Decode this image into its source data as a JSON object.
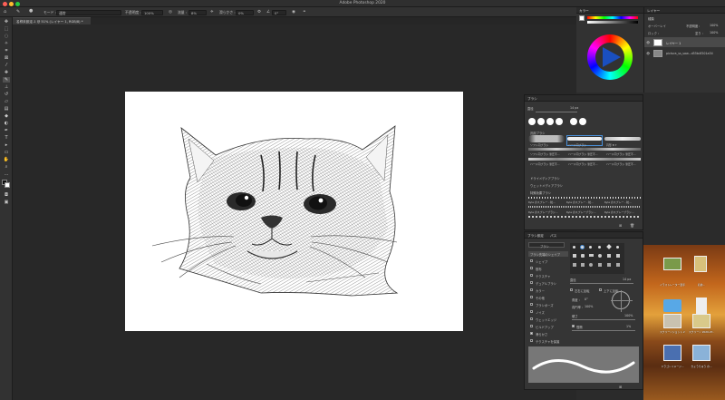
{
  "window": {
    "title": "Adobe Photoshop 2020"
  },
  "options_bar": {
    "mode_label": "モード :",
    "mode_value": "通常",
    "opacity_label": "不透明度 :",
    "opacity_value": "100%",
    "flow_label": "流量 :",
    "flow_value": "8%",
    "smoothing_label": "滑らかさ :",
    "smoothing_value": "0%",
    "angle_value": "0°"
  },
  "document_tab": {
    "label": "名称未設定-1 @ 51% (レイヤー 1, RGB/8) *"
  },
  "color_panel": {
    "title": "カラー"
  },
  "layers_panel": {
    "title": "レイヤー",
    "kind_label": "種類",
    "blend_value": "オーバーレイ",
    "opacity_label": "不透明度 :",
    "opacity_value": "100%",
    "lock_label": "ロック :",
    "fill_label": "塗り :",
    "fill_value": "100%",
    "layers": [
      {
        "name": "レイヤー 1"
      },
      {
        "name": "pictura_ss_saw...d55b4f201a34"
      }
    ]
  },
  "brush_panel": {
    "title": "ブラシ",
    "size_label": "直径",
    "size_value": "14 px",
    "groups": [
      {
        "name": "汎用ブラシ",
        "brushes": [
          "ソフト円ブラシ",
          "ハード円ブラシ",
          "円形 B 7",
          "ソフト円ブラシ 筆圧不...",
          "ハード円ブラシ 筆圧不...",
          "ハード円ブラシ 筆圧不...",
          "ハード円ブラシ 筆圧不...",
          "ハード円ブラシ 筆圧不...",
          "ハード円ブラシ 筆圧不..."
        ]
      },
      {
        "name": "ドライメディアブラシ",
        "brushes": []
      },
      {
        "name": "ウェットメディアブラシ",
        "brushes": []
      },
      {
        "name": "特殊効果ブラシ",
        "brushes": [
          "Kyle のスプレー - 粒...",
          "Kyle のスプレー - 粒...",
          "Kyle のスプレー - 粒...",
          "Kyle のスプレーブラシ...",
          "Kyle のスプレーブラシ...",
          "Kyle のスプレーブラシ..."
        ]
      }
    ]
  },
  "brush_settings": {
    "tabs": [
      "ブラシ設定",
      "パス"
    ],
    "brush_button": "ブラシ",
    "options": [
      {
        "label": "ブラシ先端のシェイプ",
        "checked": false
      },
      {
        "label": "シェイプ",
        "checked": false
      },
      {
        "label": "散布",
        "checked": false
      },
      {
        "label": "テクスチャ",
        "checked": false
      },
      {
        "label": "デュアルブラシ",
        "checked": false
      },
      {
        "label": "カラー",
        "checked": false
      },
      {
        "label": "その他",
        "checked": false
      },
      {
        "label": "ブラシポーズ",
        "checked": false
      },
      {
        "label": "ノイズ",
        "checked": false
      },
      {
        "label": "ウェットエッジ",
        "checked": false
      },
      {
        "label": "ビルドアップ",
        "checked": false
      },
      {
        "label": "滑らかさ",
        "checked": true
      },
      {
        "label": "テクスチャを保護",
        "checked": false
      }
    ],
    "size_label": "直径",
    "size_value": "14 px",
    "flip_x": "左右に反転",
    "flip_y": "上下に反転",
    "angle_label": "角度 :",
    "angle_value": "0°",
    "roundness_label": "真円率 :",
    "roundness_value": "100%",
    "hardness_label": "硬さ",
    "hardness_value": "100%",
    "spacing_label": "間隔",
    "spacing_value": "1%"
  },
  "desktop": {
    "icons": [
      {
        "label": "イラストレーター選手..."
      },
      {
        "label": "名前..."
      },
      {
        "label": ""
      },
      {
        "label": ""
      },
      {
        "label": "スクリーンショット 2020..."
      },
      {
        "label": "スクリーン 2020-07..."
      },
      {
        "label": "ドラゴンイメージ..."
      },
      {
        "label": "きょうりゅう の..."
      }
    ]
  },
  "colors": {
    "accent": "#4a90d9",
    "panel_bg": "#353535",
    "canvas": "#ffffff"
  }
}
